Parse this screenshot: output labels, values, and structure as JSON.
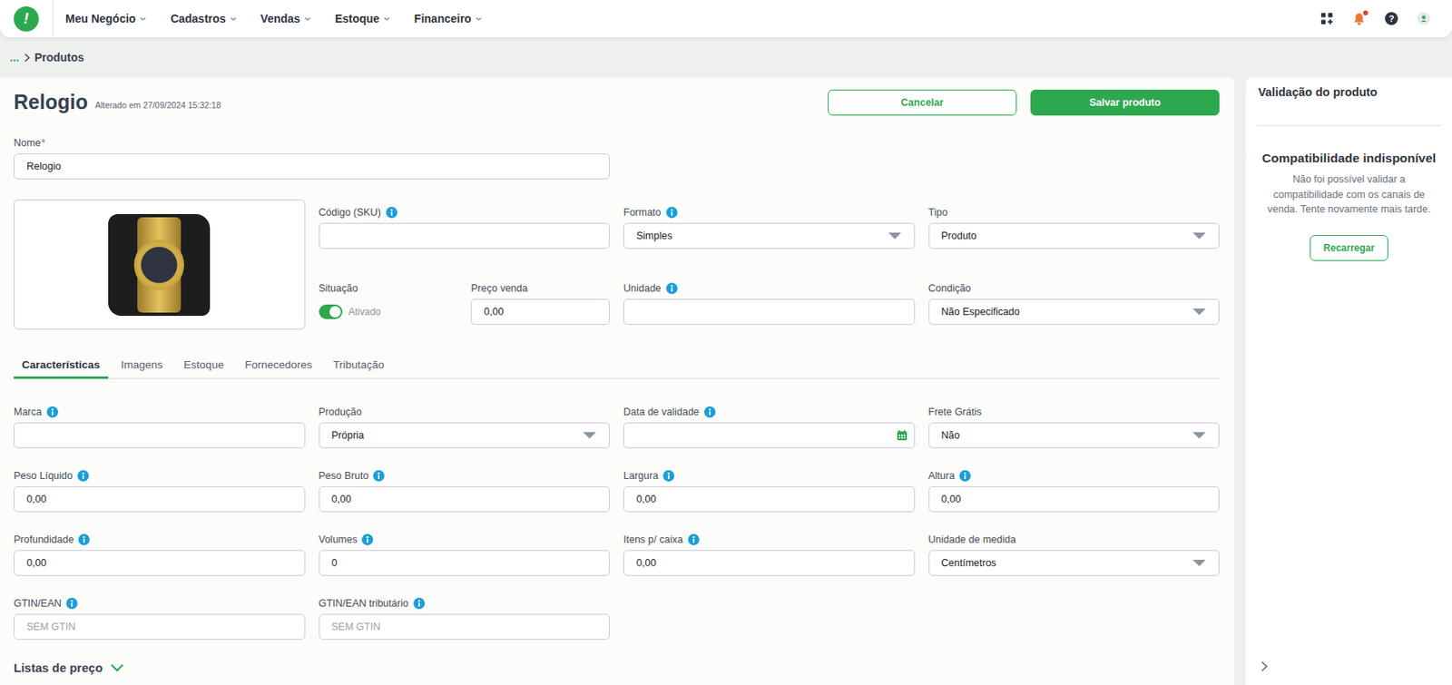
{
  "nav": {
    "logo": "!",
    "menu": [
      {
        "label": "Meu Negócio"
      },
      {
        "label": "Cadastros"
      },
      {
        "label": "Vendas"
      },
      {
        "label": "Estoque"
      },
      {
        "label": "Financeiro"
      }
    ],
    "notifications_unread": true,
    "help": "?"
  },
  "breadcrumb": {
    "ellipsis": "...",
    "current": "Produtos"
  },
  "header": {
    "title": "Relogio",
    "modified": "Alterado em 27/09/2024 15:32:18",
    "cancel": "Cancelar",
    "save": "Salvar produto"
  },
  "name_field": {
    "label": "Nome",
    "required": "*",
    "value": "Relogio"
  },
  "top_fields": [
    {
      "label": "Código (SKU)",
      "kind": "text",
      "value": "",
      "info": true
    },
    {
      "label": "Formato",
      "kind": "select",
      "value": "Simples",
      "info": true
    },
    {
      "label": "Tipo",
      "kind": "select",
      "value": "Produto",
      "info": false
    },
    {
      "label": "Situação",
      "kind": "toggle",
      "on": true,
      "value": "Ativado",
      "info": false
    },
    {
      "label": "Preço venda",
      "kind": "text",
      "value": "0,00",
      "info": false
    },
    {
      "label": "Unidade",
      "kind": "text",
      "value": "",
      "info": true
    },
    {
      "label": "Condição",
      "kind": "select",
      "value": "Não Especificado",
      "info": false
    }
  ],
  "tabs": [
    {
      "label": "Características",
      "selected": true
    },
    {
      "label": "Imagens",
      "selected": false
    },
    {
      "label": "Estoque",
      "selected": false
    },
    {
      "label": "Fornecedores",
      "selected": false
    },
    {
      "label": "Tributação",
      "selected": false
    }
  ],
  "characteristics": [
    {
      "label": "Marca",
      "kind": "text",
      "value": "",
      "info": true
    },
    {
      "label": "Produção",
      "kind": "select",
      "value": "Própria",
      "info": false
    },
    {
      "label": "Data de validade",
      "kind": "date",
      "value": "",
      "info": true
    },
    {
      "label": "Frete Grátis",
      "kind": "select",
      "value": "Não",
      "info": false
    },
    {
      "label": "Peso Líquido",
      "kind": "text",
      "value": "0,00",
      "info": true
    },
    {
      "label": "Peso Bruto",
      "kind": "text",
      "value": "0,00",
      "info": true
    },
    {
      "label": "Largura",
      "kind": "text",
      "value": "0,00",
      "info": true
    },
    {
      "label": "Altura",
      "kind": "text",
      "value": "0,00",
      "info": true
    },
    {
      "label": "Profundidade",
      "kind": "text",
      "value": "0,00",
      "info": true
    },
    {
      "label": "Volumes",
      "kind": "text",
      "value": "0",
      "info": true
    },
    {
      "label": "Itens p/ caixa",
      "kind": "text",
      "value": "0,00",
      "info": true
    },
    {
      "label": "Unidade de medida",
      "kind": "select",
      "value": "Centímetros",
      "info": false
    },
    {
      "label": "GTIN/EAN",
      "kind": "placeholder",
      "placeholder": "SEM GTIN",
      "info": true
    },
    {
      "label": "GTIN/EAN tributário",
      "kind": "placeholder",
      "placeholder": "SEM GTIN",
      "info": true
    }
  ],
  "price_lists": {
    "label": "Listas de preço",
    "expanded": false
  },
  "validation": {
    "title": "Validação do produto",
    "heading": "Compatibilidade indisponível",
    "message": "Não foi possível validar a compatibilidade com os canais de venda. Tente novamente mais tarde.",
    "button": "Recarregar"
  }
}
